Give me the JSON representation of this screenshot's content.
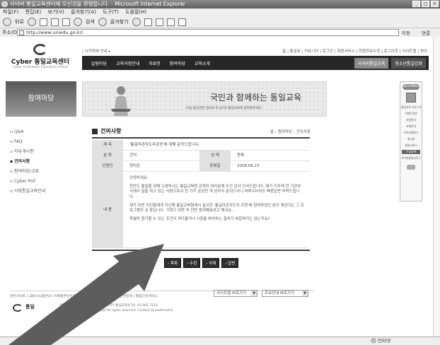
{
  "window": {
    "title": "사이버 통일교육센터에 오신것을 환영합니다. - Microsoft Internet Explorer",
    "menu": [
      "파일(F)",
      "편집(E)",
      "보기(V)",
      "즐겨찾기(A)",
      "도구(T)",
      "도움말(H)"
    ],
    "toolbar": {
      "back_label": "뒤로",
      "search_label": "검색",
      "favorites_label": "즐겨찾기"
    },
    "address_label": "주소(D)",
    "address_url": "http://www.uniedu.go.kr/",
    "go_label": "이동",
    "links_label": "연결",
    "status_zone": "인터넷"
  },
  "site": {
    "logo_name": "Cyber 통일교육센터",
    "logo_sub": "Cyber Unification Education Center",
    "topnav_left": "| 시각장애 안내 ▸",
    "topnav_right": "홈 | 통일부 | 커뮤니티 | 로그인 | 회원서비스 | 회원정보수정 | 로그아웃 | 사이트맵 | 영어",
    "gnb": [
      "알림마당",
      "교육과정안내",
      "자료방",
      "참여마당",
      "교육소개"
    ],
    "gnb_special": [
      "사이버통일교육",
      "청소년통일강좌"
    ]
  },
  "sidebar": {
    "title": "참여마당",
    "items": [
      {
        "label": "Q&A",
        "active": false
      },
      {
        "label": "FAQ",
        "active": false
      },
      {
        "label": "자유게시판",
        "active": false
      },
      {
        "label": "건의사항",
        "active": true
      },
      {
        "label": "참여마당/교류",
        "active": false
      },
      {
        "label": "Cyber Poll",
        "active": false
      },
      {
        "label": "사회통일교육안내",
        "active": false
      }
    ]
  },
  "banner": {
    "headline": "국민과 함께하는 통일교육",
    "subline": "다음 통일관련 정보와 지식으로 통일교육에 참여해주세요."
  },
  "quick_menu": {
    "title": "QuickMenu",
    "items": [
      "통일교육 프로그램안내",
      "이벤트정보",
      "자원봉사",
      "교재안내",
      "사이버캠퍼스",
      "게시판",
      "회원서비스"
    ],
    "highlight": "수강등록",
    "extra": "사이버통일교육 안내"
  },
  "content": {
    "title": "건의사항",
    "breadcrumb": "› 홈 › 참여마당 › 건의사항",
    "labels": {
      "subject": "제 목",
      "category": "분 류",
      "status": "상 태",
      "author": "신청인",
      "date": "등록일",
      "body": "내 용"
    },
    "subject": "'통일마관지도자과정'에 대해 문의드립니다.",
    "category": "건의",
    "status": "등록",
    "author": "정미은",
    "date": "2008.06.23",
    "body": [
      "안녕하세요.",
      "한반도 통일을 위해 고생하시는 통일교육원 관계자 여러분께 우선 감사 인사드립니다. 제가 지자체 한 기관부서에서 일을 하고 있는 사람으로서 한 가지 궁금한 게 있어서 문의드리니 바쁘시더라도 빠른답변 부탁드립니다.",
      "제가 이번 지인들에게 지난해 통일교육원에서 실시한 '통일마관지도자 과정'에 참여하셨던 분이 계신다는 그 프로그램이 궁 중입니다. 기회가 되면 꼭 한번 참여해보려고 해서요…",
      "특별히 참가할 수 있는 조건이 까다롭거나 시험을 봐야하는 절차가 복잡하지는 않는지요?"
    ],
    "buttons": [
      "› 목록",
      "› 수정",
      "› 삭제",
      "› 답변"
    ]
  },
  "footer": {
    "links": "관련사이트 | 교육시스템안내 | 이메일무단수집거부 | 개인정보보호정책 | 웹접근성정책 | 웹접근성서비스",
    "select1": "사이트맵 바로가기",
    "select2": "주요안내 바로가기",
    "logo_text": "통일",
    "address": "서울특별시 강북구 수유동 (우) 142-075 통일교육원 Tel. 02.901.7114",
    "copyright": "Copyright (C) 2008 통일교육원 All rights reserved. Contact to webmaster."
  }
}
